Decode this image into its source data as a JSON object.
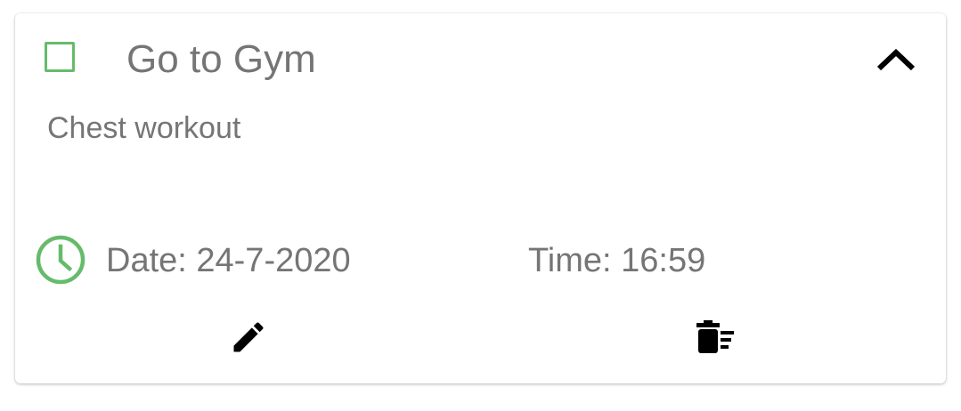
{
  "task": {
    "title": "Go to Gym",
    "description": "Chest workout",
    "date_text": "Date: 24-7-2020",
    "time_text": "Time: 16:59",
    "completed": false
  },
  "icons": {
    "checkbox": "checkbox-outline-icon",
    "collapse": "chevron-up-icon",
    "clock": "clock-icon",
    "edit": "pencil-icon",
    "delete": "delete-sweep-icon"
  },
  "colors": {
    "accent": "#66bb6a",
    "text": "#757575",
    "icon": "#000000"
  }
}
